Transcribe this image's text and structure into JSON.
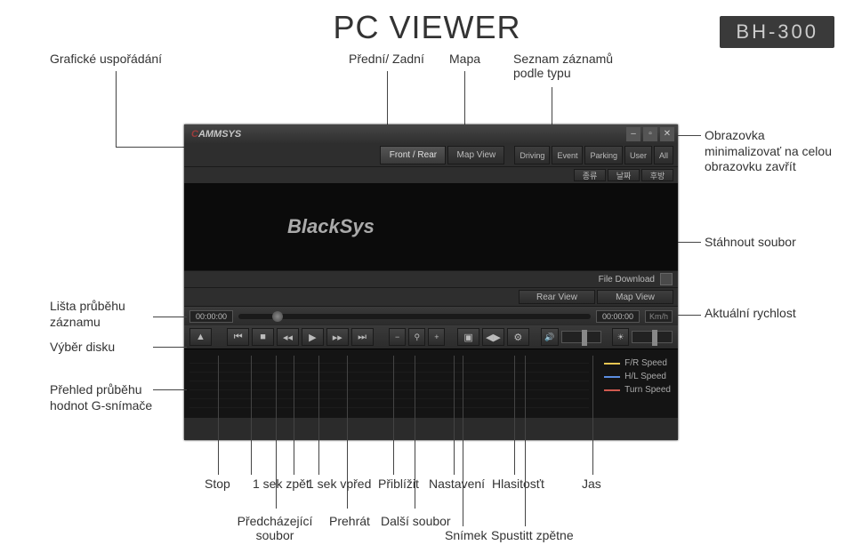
{
  "page_title": "PC VIEWER",
  "model": "BH-300",
  "top_annotations": {
    "layout": "Grafické uspořádání",
    "front_rear": "Přední/ Zadní",
    "map": "Mapa",
    "record_list": "Seznam záznamů\npodle typu"
  },
  "viewer": {
    "brand": "CAMMSYS",
    "win_ctrls": [
      "–",
      "▫",
      "✕"
    ],
    "tabs": {
      "front_rear": "Front / Rear",
      "map_view": "Map View"
    },
    "filter_tabs": [
      "Driving",
      "Event",
      "Parking",
      "User",
      "All"
    ],
    "filter_sub": [
      "종류",
      "날짜",
      "후방"
    ],
    "splash": "BlackSys",
    "download": "File Download",
    "lower_tabs": {
      "rear": "Rear View",
      "map": "Map View"
    },
    "progress": {
      "start": "00:00:00",
      "end": "00:00:00",
      "speed": "Km/h"
    },
    "legend": [
      {
        "label": "F/R Speed",
        "color": "#e7c552"
      },
      {
        "label": "H/L Speed",
        "color": "#5b8de0"
      },
      {
        "label": "Turn Speed",
        "color": "#d05a4f"
      }
    ]
  },
  "left_annotations": {
    "progress": "Lišta průběhu záznamu",
    "disk": "Výběr disku",
    "gsensor": "Přehled průběhu hodnot G-snímače"
  },
  "right_annotations": {
    "screen": "Obrazovka minimalizovať na celou obrazovku zavřít",
    "download": "Stáhnout soubor",
    "speed": "Aktuální rychlost"
  },
  "bottom_annotations": {
    "row1": {
      "stop": "Stop",
      "back": "1 sek zpět",
      "fwd": "1 sek vpřed",
      "zoom": "Přiblížit",
      "settings": "Nastavení",
      "volume": "Hlasitosťt",
      "brightness": "Jas"
    },
    "row2": {
      "prev": "Předcházející soubor",
      "play": "Prehrát",
      "next": "Další soubor",
      "frame": "Snímek",
      "backward": "Spustitt zpětne"
    }
  }
}
